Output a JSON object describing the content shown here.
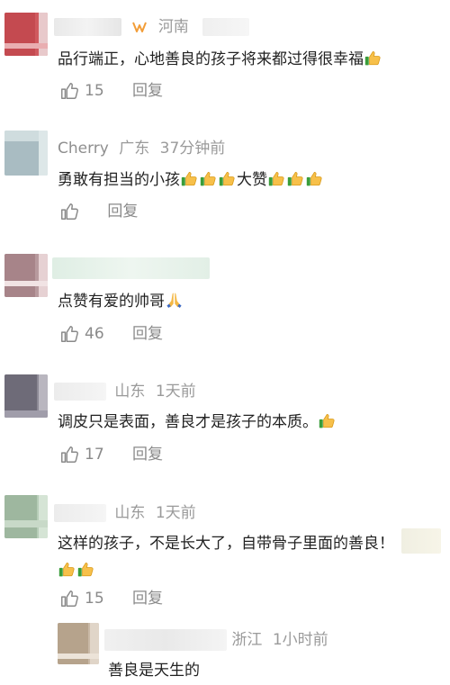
{
  "comments": [
    {
      "location": "河南",
      "text": "品行端正，心地善良的孩子将来都过得很幸福",
      "likes": "15",
      "reply_label": "回复",
      "avatar_colors": [
        "#d05a5f",
        "#c44a50",
        "#e07c80"
      ]
    },
    {
      "username": "Cherry",
      "location": "广东",
      "time": "37分钟前",
      "text": "勇敢有担当的小孩",
      "text2": "大赞",
      "reply_label": "回复",
      "avatar_colors": [
        "#b8c8cc",
        "#a9bcc2",
        "#cfe0e2"
      ]
    },
    {
      "text": "点赞有爱的帅哥",
      "likes": "46",
      "reply_label": "回复",
      "avatar_colors": [
        "#b89a9e",
        "#a78489",
        "#e6d1d3"
      ]
    },
    {
      "location": "山东",
      "time": "1天前",
      "text": "调皮只是表面，善良才是孩子的本质。",
      "likes": "17",
      "reply_label": "回复",
      "avatar_colors": [
        "#8d8a96",
        "#6e6b78",
        "#b9b6bf"
      ]
    },
    {
      "location": "山东",
      "time": "1天前",
      "text": "这样的孩子，不是长大了，自带骨子里面的善良！",
      "likes": "15",
      "reply_label": "回复",
      "avatar_colors": [
        "#b7cdb8",
        "#9eb79f",
        "#d5e4d5"
      ]
    },
    {
      "location": "浙江",
      "time": "1小时前",
      "text": "善良是天生的",
      "avatar_colors": [
        "#c9b9a6",
        "#b6a38c",
        "#e0d5c8"
      ]
    }
  ]
}
